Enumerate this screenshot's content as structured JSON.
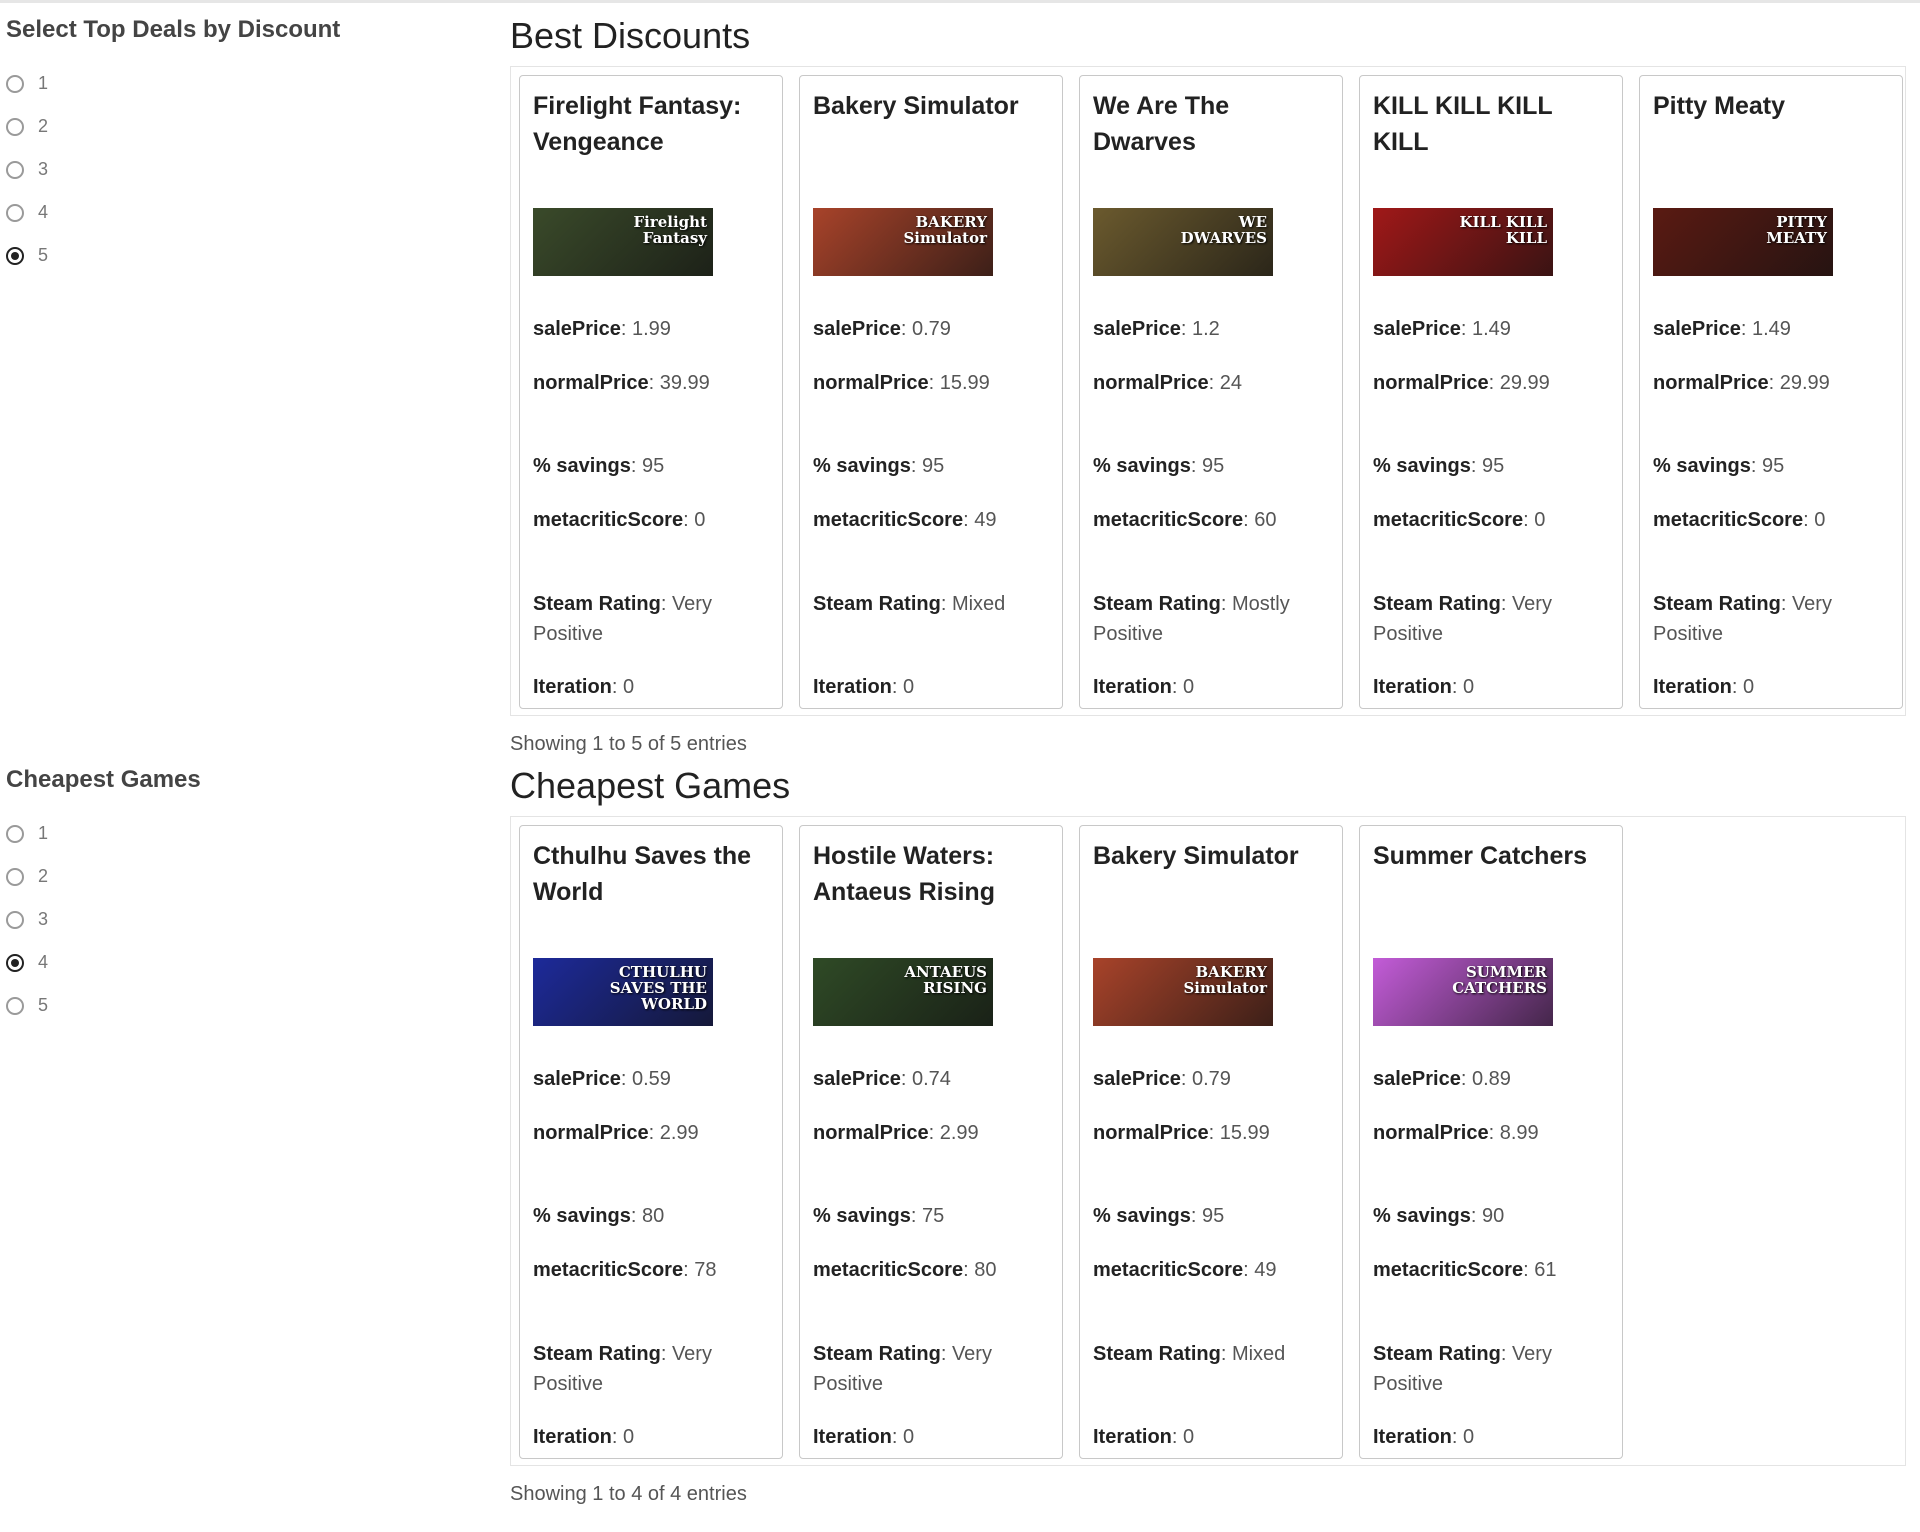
{
  "discount_section": {
    "sidebar_title": "Select Top Deals by Discount",
    "radio_options": [
      "1",
      "2",
      "3",
      "4",
      "5"
    ],
    "selected": "5",
    "title": "Best Discounts",
    "entries_text": "Showing 1 to 5 of 5 entries",
    "cards": [
      {
        "title": "Firelight Fantasy: Vengeance",
        "thumb_text": "Firelight Fantasy",
        "thumb_bg": "#3a4a2a",
        "sale": "1.99",
        "normal": "39.99",
        "savings": "95",
        "meta": "0",
        "steam": "Very Positive",
        "iteration": "0"
      },
      {
        "title": "Bakery Simulator",
        "thumb_text": "BAKERY Simulator",
        "thumb_bg": "#a8432a",
        "sale": "0.79",
        "normal": "15.99",
        "savings": "95",
        "meta": "49",
        "steam": "Mixed",
        "iteration": "0"
      },
      {
        "title": "We Are The Dwarves",
        "thumb_text": "WE DWARVES",
        "thumb_bg": "#6b5a2e",
        "sale": "1.2",
        "normal": "24",
        "savings": "95",
        "meta": "60",
        "steam": "Mostly Positive",
        "iteration": "0"
      },
      {
        "title": "KILL KILL KILL KILL",
        "thumb_text": "KILL KILL KILL",
        "thumb_bg": "#a01818",
        "sale": "1.49",
        "normal": "29.99",
        "savings": "95",
        "meta": "0",
        "steam": "Very Positive",
        "iteration": "0"
      },
      {
        "title": "Pitty Meaty",
        "thumb_text": "PITTY MEATY",
        "thumb_bg": "#5a1a12",
        "sale": "1.49",
        "normal": "29.99",
        "savings": "95",
        "meta": "0",
        "steam": "Very Positive",
        "iteration": "0"
      }
    ]
  },
  "cheapest_section": {
    "sidebar_title": "Cheapest Games",
    "radio_options": [
      "1",
      "2",
      "3",
      "4",
      "5"
    ],
    "selected": "4",
    "title": "Cheapest Games",
    "entries_text": "Showing 1 to 4 of 4 entries",
    "cards": [
      {
        "title": "Cthulhu Saves the World",
        "thumb_text": "CTHULHU SAVES THE WORLD",
        "thumb_bg": "#1d2a9a",
        "sale": "0.59",
        "normal": "2.99",
        "savings": "80",
        "meta": "78",
        "steam": "Very Positive",
        "iteration": "0"
      },
      {
        "title": "Hostile Waters: Antaeus Rising",
        "thumb_text": "ANTAEUS RISING",
        "thumb_bg": "#2f4a26",
        "sale": "0.74",
        "normal": "2.99",
        "savings": "75",
        "meta": "80",
        "steam": "Very Positive",
        "iteration": "0"
      },
      {
        "title": "Bakery Simulator",
        "thumb_text": "BAKERY Simulator",
        "thumb_bg": "#a8432a",
        "sale": "0.79",
        "normal": "15.99",
        "savings": "95",
        "meta": "49",
        "steam": "Mixed",
        "iteration": "0"
      },
      {
        "title": "Summer Catchers",
        "thumb_text": "SUMMER CATCHERS",
        "thumb_bg": "#c35cd8",
        "sale": "0.89",
        "normal": "8.99",
        "savings": "90",
        "meta": "61",
        "steam": "Very Positive",
        "iteration": "0"
      }
    ]
  },
  "labels": {
    "sale": "salePrice",
    "normal": "normalPrice",
    "savings": "% savings",
    "meta": "metacriticScore",
    "steam": "Steam Rating",
    "iteration": "Iteration"
  }
}
